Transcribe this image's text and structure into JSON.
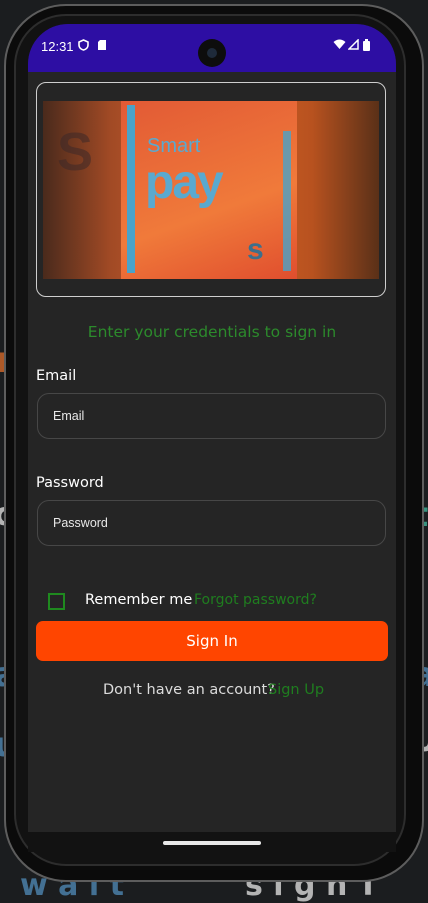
{
  "status": {
    "time": "12:31",
    "icons_left": [
      "shield-icon",
      "sim-icon"
    ],
    "icons_right": [
      "wifi-icon",
      "signal-icon",
      "battery-icon"
    ]
  },
  "banner": {
    "logo_smart": "Smart",
    "logo_pay": "pay",
    "logo_s": "s"
  },
  "login": {
    "subtitle": "Enter your credentials to sign in",
    "email_label": "Email",
    "email_placeholder": "Email",
    "password_label": "Password",
    "password_placeholder": "Password",
    "remember_label": "Remember me",
    "forgot_link": "Forgot password?",
    "signin_button": "Sign In",
    "no_account_text": "Don't have an account?",
    "signup_link": "Sign Up"
  },
  "colors": {
    "statusbar": "#2d0ea3",
    "accent_green": "#1f7d1f",
    "primary_button": "#ff4500",
    "screen_bg": "#252525"
  }
}
